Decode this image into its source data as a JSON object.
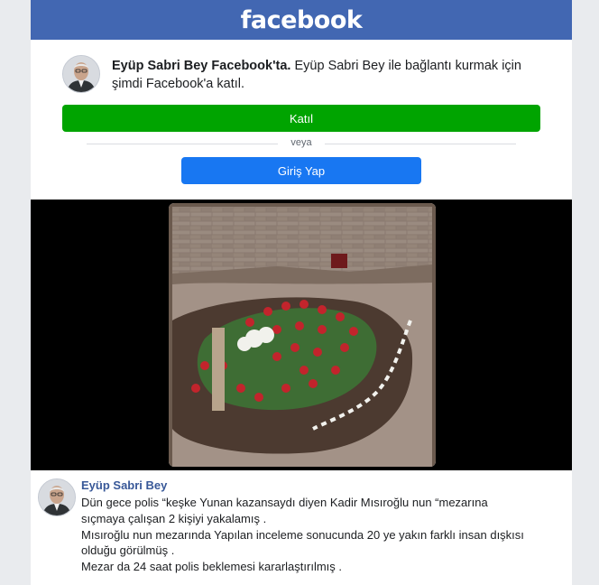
{
  "header": {
    "logo": "facebook"
  },
  "connect": {
    "name_lead": "Eyüp Sabri Bey Facebook'ta.",
    "message": " Eyüp Sabri Bey ile bağlantı kurmak için şimdi Facebook'a katıl.",
    "join_label": "Katıl",
    "separator": "veya",
    "login_label": "Giriş Yap"
  },
  "post": {
    "author": "Eyüp Sabri Bey",
    "lines": [
      "Dün gece polis “keşke Yunan kazansaydı diyen Kadir Mısıroğlu nun “mezarına",
      "sıçmaya çalışan 2 kişiyi yakalamış .",
      "Mısıroğlu nun mezarında Yapılan inceleme sonucunda 20 ye yakın farklı insan dışkısı",
      "olduğu görülmüş .",
      "Mezar da 24 saat polis beklemesi kararlaştırılmış ."
    ]
  },
  "colors": {
    "brand_blue": "#4267b2",
    "join_green": "#00a400",
    "login_blue": "#1877f2",
    "author_link": "#385898"
  },
  "icons": {
    "avatar": "profile-photo",
    "media": "grave-photo"
  }
}
